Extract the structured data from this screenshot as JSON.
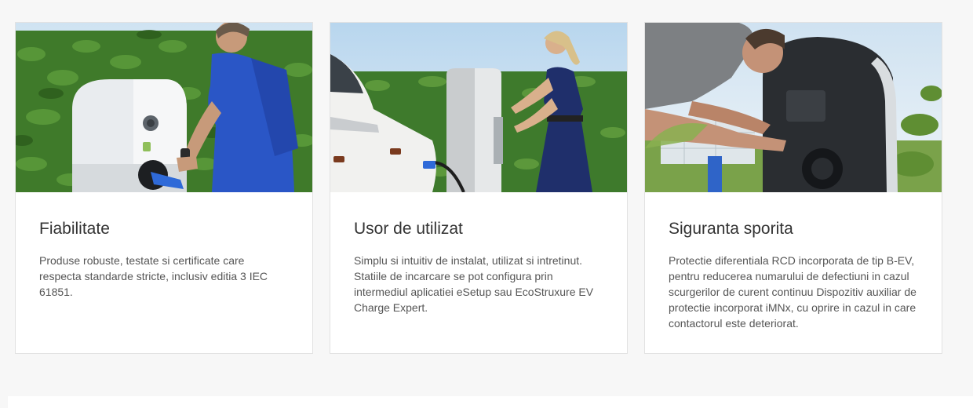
{
  "cards": [
    {
      "image_alt": "Barbat conectand cablul de incarcare la o statie EV alba",
      "title": "Fiabilitate",
      "text": "Produse robuste, testate si certificate care respecta standarde stricte, inclusiv editia 3 IEC 61851."
    },
    {
      "image_alt": "Femeie in rochie albastra incarcand un autoturism alb la o statie EV",
      "title": "Usor de utilizat",
      "text": "Simplu si intuitiv de instalat, utilizat si intretinut. Statiile de incarcare se pot configura prin intermediul aplicatiei eSetup sau EcoStruxure EV Charge Expert."
    },
    {
      "image_alt": "Tehnician verificand interiorul unei statii de incarcare",
      "title": "Siguranta sporita",
      "text": "Protectie diferentiala RCD incorporata de tip B-EV, pentru reducerea numarului de defectiuni in cazul scurgerilor de curent continuu Dispozitiv auxiliar de protectie incorporat iMNx, cu oprire in cazul in care contactorul este deteriorat."
    }
  ],
  "colors": {
    "page_bg": "#f7f7f7",
    "card_bg": "#ffffff",
    "card_border": "#e2e2e2",
    "title": "#333333",
    "text": "#555555",
    "hedge": "#3f7a2a",
    "shirt_blue": "#2a56c6",
    "dress_navy": "#1f2f6b"
  }
}
